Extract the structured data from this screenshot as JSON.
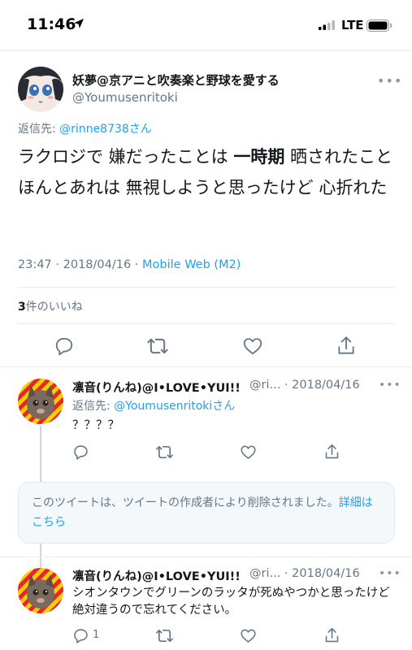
{
  "status_bar": {
    "time": "11:46",
    "network": "LTE"
  },
  "main_tweet": {
    "author_name": "妖夢@京アニと吹奏楽と野球を愛する",
    "author_handle": "@Youmusenritoki",
    "reply_prefix": "返信先: ",
    "reply_handle": "@rinne8738さん",
    "text_before": "ラクロジで 嫌だったことは ",
    "text_bold": "一時期",
    "text_after": " 晒されたこと  ほんとあれは 無視しようと思ったけど 心折れた",
    "timestamp": "23:47 · 2018/04/16 · ",
    "client": "Mobile Web (M2)",
    "likes_count": "3",
    "likes_label": "件のいいね"
  },
  "replies": [
    {
      "name": "凛音(りんね)@I•LOVE•YUI!!",
      "handle_date": "@ri... · 2018/04/16",
      "reply_prefix": "返信先: ",
      "reply_handle": "@Youmusenritokiさん",
      "text": "？？？？",
      "reply_count": ""
    },
    {
      "name": "凛音(りんね)@I•LOVE•YUI!!",
      "handle_date": "@ri... · 2018/04/16",
      "text": "シオンタウンでグリーンのラッタが死ぬやつかと思ったけど絶対違うので忘れてください。",
      "reply_count": "1"
    }
  ],
  "deleted_notice": {
    "text": "このツイートは、ツイートの作成者により削除されました。",
    "link": "詳細はこちら"
  },
  "colors": {
    "accent": "#1da1f2",
    "secondary_text": "#657786",
    "border": "#e6ecf0"
  }
}
